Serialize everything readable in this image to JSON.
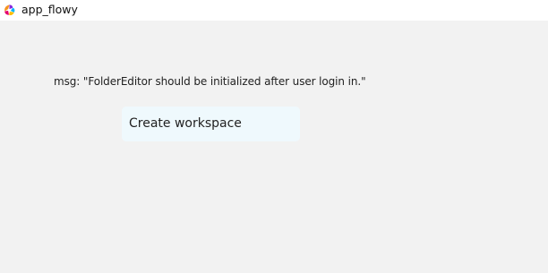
{
  "window": {
    "title": "app_flowy",
    "logo_icon": "appflowy-logo-icon"
  },
  "content": {
    "message": "msg: \"FolderEditor should be initialized after user login in.\"",
    "create_button_label": "Create workspace"
  },
  "colors": {
    "titlebar_bg": "#ffffff",
    "content_bg": "#f2f2f2",
    "button_bg": "#eff9fd",
    "text": "#222222"
  }
}
